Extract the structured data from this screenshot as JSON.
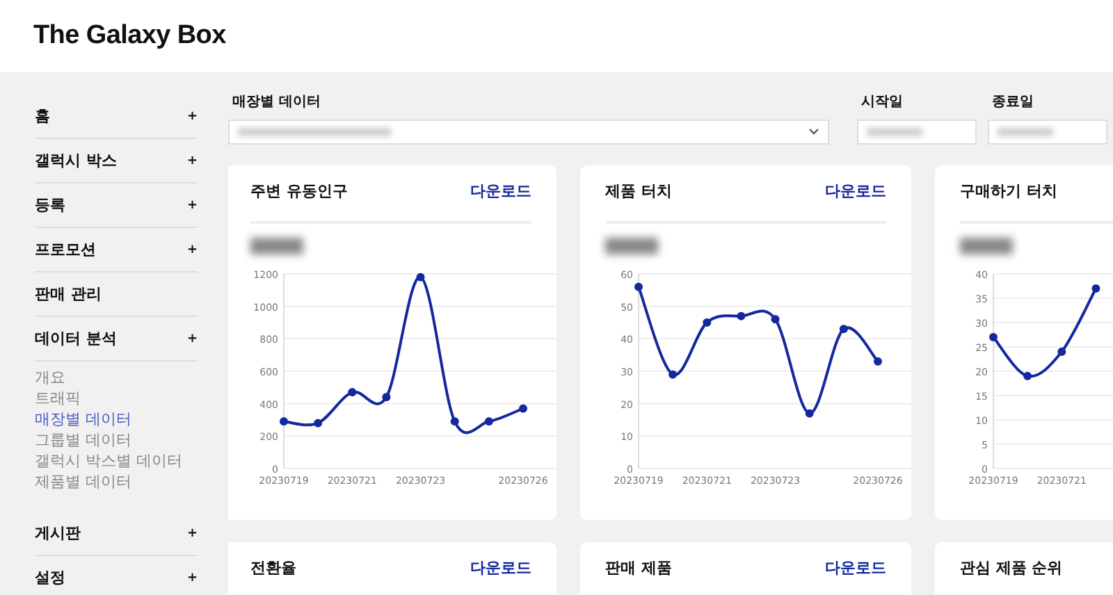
{
  "header": {
    "title": "The Galaxy Box"
  },
  "sidebar": {
    "items": [
      {
        "label": "홈",
        "toggle": "+"
      },
      {
        "label": "갤럭시 박스",
        "toggle": "+"
      },
      {
        "label": "등록",
        "toggle": "+"
      },
      {
        "label": "프로모션",
        "toggle": "+"
      },
      {
        "label": "판매 관리"
      },
      {
        "label": "데이터 분석",
        "toggle": "+",
        "children": [
          {
            "label": "개요",
            "selected": false
          },
          {
            "label": "트래픽",
            "selected": false
          },
          {
            "label": "매장별 데이터",
            "selected": true
          },
          {
            "label": "그룹별 데이터",
            "selected": false
          },
          {
            "label": "갤럭시 박스별 데이터",
            "selected": false
          },
          {
            "label": "제품별 데이터",
            "selected": false
          }
        ]
      },
      {
        "label": "게시판",
        "toggle": "+"
      },
      {
        "label": "설정",
        "toggle": "+"
      }
    ]
  },
  "filters": {
    "store_label": "매장별 데이터",
    "start_label": "시작일",
    "end_label": "종료일"
  },
  "cards": [
    {
      "title": "주변 유동인구",
      "download": "다운로드",
      "chart_data": {
        "type": "line",
        "categories": [
          "20230719",
          null,
          "20230721",
          null,
          "20230723",
          null,
          null,
          "20230726"
        ],
        "grid": true,
        "series": [
          {
            "color": "#1428a0",
            "marker": true,
            "values": [
              290,
              280,
              470,
              440,
              1180,
              290,
              290,
              370
            ]
          }
        ],
        "ylim": [
          0,
          1200
        ],
        "yticks": [
          0,
          200,
          400,
          600,
          800,
          1000,
          1200
        ]
      }
    },
    {
      "title": "제품 터치",
      "download": "다운로드",
      "chart_data": {
        "type": "line",
        "categories": [
          "20230719",
          null,
          "20230721",
          null,
          "20230723",
          null,
          null,
          "20230726"
        ],
        "grid": true,
        "series": [
          {
            "color": "#1428a0",
            "marker": true,
            "values": [
              56,
              29,
              45,
              47,
              46,
              17,
              43,
              33
            ]
          }
        ],
        "ylim": [
          0,
          60
        ],
        "yticks": [
          0,
          10,
          20,
          30,
          40,
          50,
          60
        ]
      }
    },
    {
      "title": "구매하기 터치",
      "chart_data": {
        "type": "line",
        "categories": [
          "20230719",
          null,
          "20230721",
          null,
          null,
          null,
          null,
          null
        ],
        "grid": true,
        "series": [
          {
            "color": "#1428a0",
            "marker": true,
            "values": [
              27,
              19,
              24,
              37,
              null,
              null,
              null,
              null
            ]
          }
        ],
        "ylim": [
          0,
          40
        ],
        "yticks": [
          0,
          5,
          10,
          15,
          20,
          25,
          30,
          35,
          40
        ]
      }
    },
    {
      "title": "전환율",
      "download": "다운로드"
    },
    {
      "title": "판매 제품",
      "download": "다운로드"
    },
    {
      "title": "관심 제품 순위"
    }
  ]
}
